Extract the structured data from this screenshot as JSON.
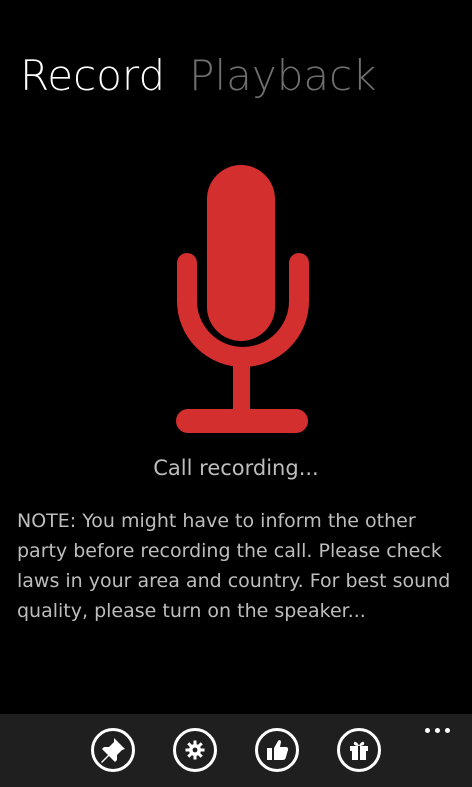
{
  "pivot": {
    "tabs": [
      {
        "label": "Record",
        "active": true
      },
      {
        "label": "Playback",
        "active": false
      }
    ]
  },
  "main": {
    "icon": "microphone-icon",
    "status": "Call recording...",
    "note": "NOTE: You might have to inform the other party before recording the call. Please check laws in your area and country. For best sound quality, please turn on the speaker..."
  },
  "app_bar": {
    "buttons": [
      {
        "icon": "pin-icon"
      },
      {
        "icon": "settings-icon"
      },
      {
        "icon": "thumbs-up-icon"
      },
      {
        "icon": "gift-icon"
      }
    ],
    "more_icon": "more-icon"
  },
  "colors": {
    "background": "#000000",
    "accent": "#d32f2f",
    "inactive_tab": "#6f6f6f",
    "body_text": "#bdbdbd",
    "app_bar": "#1f1f1f"
  }
}
